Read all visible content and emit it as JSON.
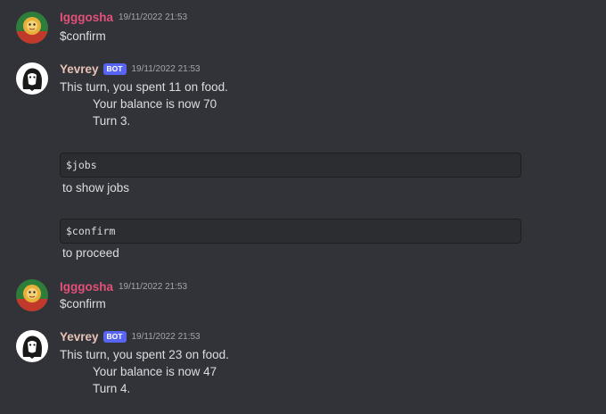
{
  "messages": [
    {
      "author": "Igggosha",
      "timestamp": "19/11/2022 21:53",
      "text": "$confirm"
    },
    {
      "author": "Yevrey",
      "badge": "BOT",
      "timestamp": "19/11/2022 21:53",
      "lines": [
        "This turn, you spent 11 on food.",
        "Your balance is now 70",
        "Turn 3."
      ],
      "code_blocks": [
        {
          "code": "$jobs",
          "caption": "to show jobs"
        },
        {
          "code": "$confirm",
          "caption": "to proceed"
        }
      ]
    },
    {
      "author": "Igggosha",
      "timestamp": "19/11/2022 21:53",
      "text": "$confirm"
    },
    {
      "author": "Yevrey",
      "badge": "BOT",
      "timestamp": "19/11/2022 21:53",
      "lines": [
        "This turn, you spent 23 on food.",
        "Your balance is now 47",
        "Turn 4."
      ]
    }
  ],
  "colors": {
    "background": "#313338",
    "user_name": "#e3507a",
    "bot_name": "#e8c2b6",
    "bot_badge": "#5865f2"
  }
}
